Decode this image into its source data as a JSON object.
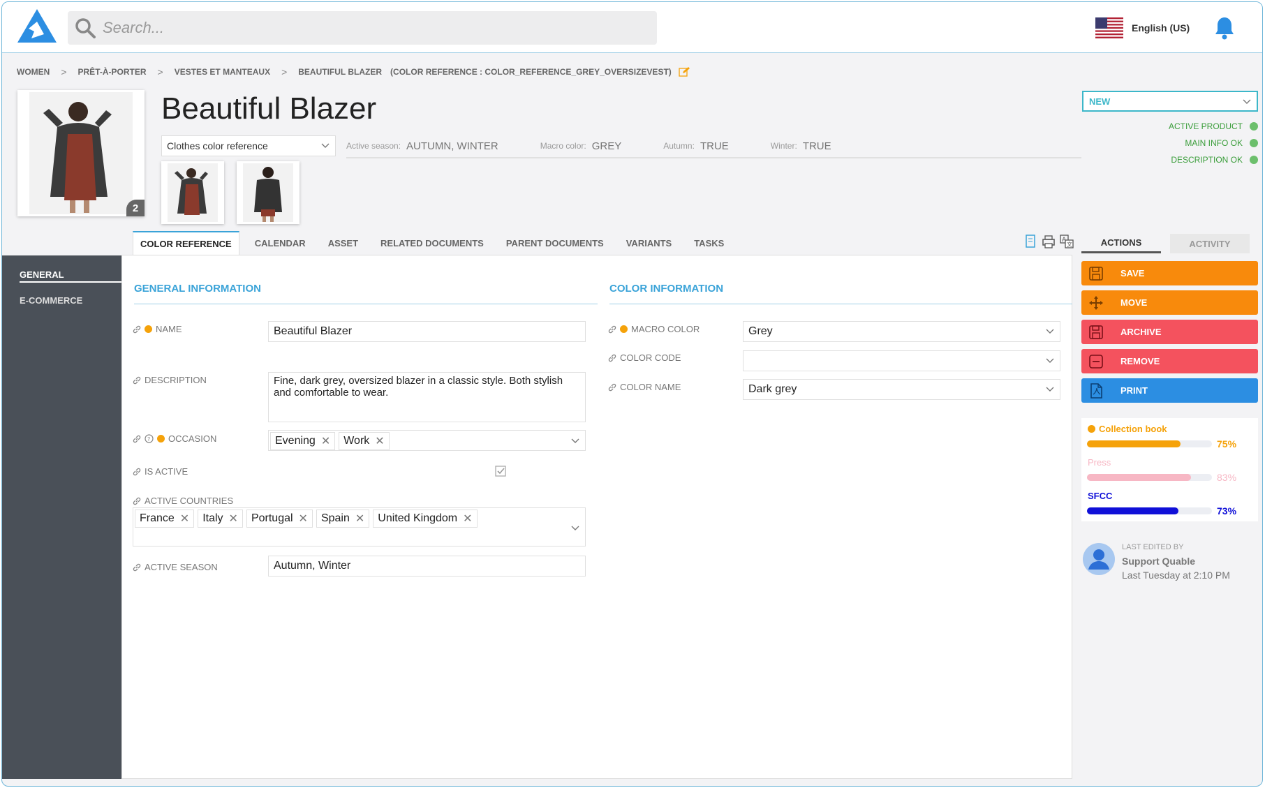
{
  "header": {
    "search_placeholder": "Search...",
    "language": "English (US)"
  },
  "breadcrumb": {
    "items": [
      "WOMEN",
      "PRÊT-À-PORTER",
      "VESTES ET MANTEAUX",
      "BEAUTIFUL BLAZER"
    ],
    "separator": ">",
    "reference": "(COLOR REFERENCE : COLOR_REFERENCE_GREY_OVERSIZEVEST)"
  },
  "product": {
    "title": "Beautiful Blazer",
    "image_count": "2",
    "reference_type": "Clothes color reference",
    "meta": [
      {
        "key": "Active season:",
        "value": "AUTUMN, WINTER"
      },
      {
        "key": "Macro color:",
        "value": "GREY"
      },
      {
        "key": "Autumn:",
        "value": "TRUE"
      },
      {
        "key": "Winter:",
        "value": "TRUE"
      }
    ],
    "status": "NEW",
    "checks": [
      "ACTIVE PRODUCT",
      "MAIN INFO OK",
      "DESCRIPTION OK"
    ]
  },
  "tabs": [
    "COLOR REFERENCE",
    "CALENDAR",
    "ASSET",
    "RELATED DOCUMENTS",
    "PARENT DOCUMENTS",
    "VARIANTS",
    "TASKS"
  ],
  "sidenav": [
    "GENERAL",
    "E-COMMERCE"
  ],
  "general": {
    "title": "GENERAL INFORMATION",
    "name_label": "NAME",
    "name_value": "Beautiful Blazer",
    "description_label": "DESCRIPTION",
    "description_value": "Fine, dark grey, oversized blazer in a classic style. Both stylish and comfortable to wear.",
    "occasion_label": "OCCASION",
    "occasion_tags": [
      "Evening",
      "Work"
    ],
    "is_active_label": "IS ACTIVE",
    "is_active": true,
    "countries_label": "ACTIVE COUNTRIES",
    "country_tags": [
      "France",
      "Italy",
      "Portugal",
      "Spain",
      "United Kingdom"
    ],
    "season_label": "ACTIVE SEASON",
    "season_value": "Autumn, Winter"
  },
  "color": {
    "title": "COLOR INFORMATION",
    "macro_label": "MACRO COLOR",
    "macro_value": "Grey",
    "code_label": "COLOR CODE",
    "code_value": "",
    "name_label": "COLOR NAME",
    "name_value": "Dark grey"
  },
  "right_panel": {
    "tabs": [
      "ACTIONS",
      "ACTIVITY"
    ],
    "actions": [
      {
        "label": "SAVE",
        "color": "#f88a0c"
      },
      {
        "label": "MOVE",
        "color": "#f88a0c"
      },
      {
        "label": "ARCHIVE",
        "color": "#f4525e"
      },
      {
        "label": "REMOVE",
        "color": "#f4525e"
      },
      {
        "label": "PRINT",
        "color": "#2c8ee2"
      }
    ],
    "progress": [
      {
        "label": "Collection book",
        "pct_text": "75%",
        "value": 75,
        "color": "#f5a20a"
      },
      {
        "label": "Press",
        "pct_text": "83%",
        "value": 83,
        "color": "#f7b7c4"
      },
      {
        "label": "SFCC",
        "pct_text": "73%",
        "value": 73,
        "color": "#1010d8"
      }
    ],
    "last_edited_label": "LAST EDITED BY",
    "last_edited_name": "Support Quable",
    "last_edited_when": "Last Tuesday at 2:10 PM"
  }
}
